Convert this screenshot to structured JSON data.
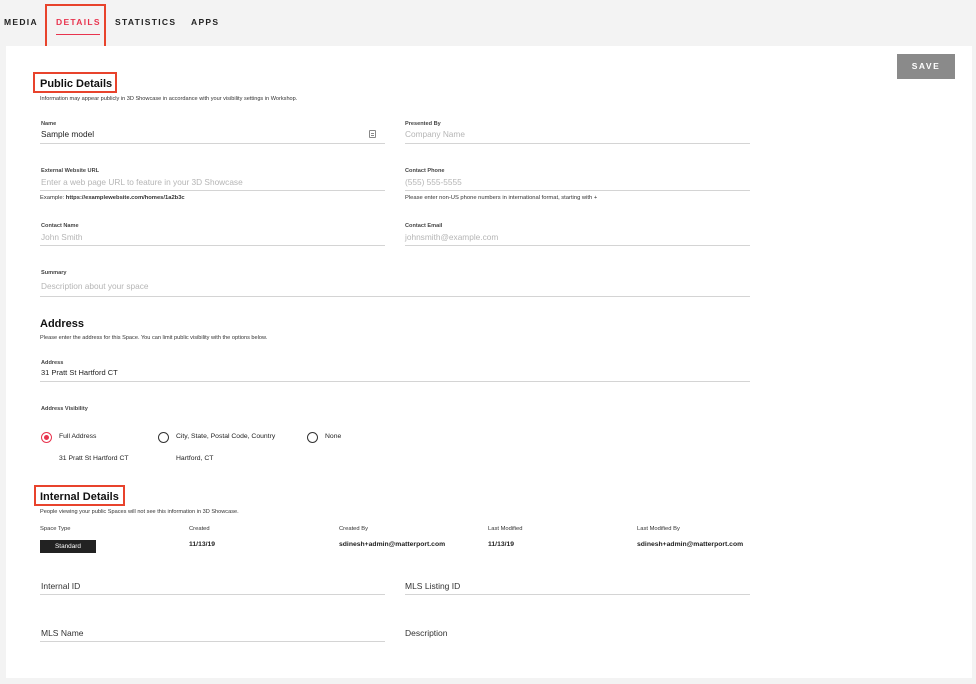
{
  "tabs": [
    {
      "label": "MEDIA"
    },
    {
      "label": "DETAILS"
    },
    {
      "label": "STATISTICS"
    },
    {
      "label": "APPS"
    }
  ],
  "save_label": "SAVE",
  "public": {
    "title": "Public Details",
    "description": "Information may appear publicly in 3D Showcase in accordance with your visibility settings in Workshop.",
    "name": {
      "label": "Name",
      "value": "Sample model"
    },
    "presented_by": {
      "label": "Presented By",
      "placeholder": "Company Name"
    },
    "website": {
      "label": "External Website URL",
      "placeholder": "Enter a web page URL to feature in your 3D Showcase",
      "hint_prefix": "Example: ",
      "hint_example": "https://examplewebsite.com/homes/1a2b3c"
    },
    "phone": {
      "label": "Contact Phone",
      "placeholder": "(555) 555-5555",
      "hint": "Please enter non-US phone numbers in international format, starting with +"
    },
    "contact_name": {
      "label": "Contact Name",
      "placeholder": "John Smith"
    },
    "contact_email": {
      "label": "Contact Email",
      "placeholder": "johnsmith@example.com"
    },
    "summary": {
      "label": "Summary",
      "placeholder": "Description about your space"
    }
  },
  "address": {
    "title": "Address",
    "description": "Please enter the address for this Space. You can limit public visibility with the options below.",
    "label": "Address",
    "value": "31 Pratt St Hartford CT",
    "visibility_label": "Address Visibility",
    "options": [
      {
        "label": "Full Address",
        "sub": "31 Pratt St Hartford CT",
        "selected": true
      },
      {
        "label": "City, State, Postal Code, Country",
        "sub": "Hartford, CT",
        "selected": false
      },
      {
        "label": "None",
        "sub": "",
        "selected": false
      }
    ]
  },
  "internal": {
    "title": "Internal Details",
    "description": "People viewing your public Spaces will not see this information in 3D Showcase.",
    "space_type": {
      "label": "Space Type",
      "value": "Standard"
    },
    "created": {
      "label": "Created",
      "value": "11/13/19"
    },
    "created_by": {
      "label": "Created By",
      "value": "sdinesh+admin@matterport.com"
    },
    "last_modified": {
      "label": "Last Modified",
      "value": "11/13/19"
    },
    "last_modified_by": {
      "label": "Last Modified By",
      "value": "sdinesh+admin@matterport.com"
    },
    "internal_id": {
      "label": "Internal ID"
    },
    "mls_listing_id": {
      "label": "MLS Listing ID"
    },
    "mls_name": {
      "label": "MLS Name"
    },
    "description_field": {
      "label": "Description"
    }
  },
  "colors": {
    "accent": "#e8344e",
    "highlight": "#e8432c",
    "save_bg": "#8a8a8a"
  }
}
